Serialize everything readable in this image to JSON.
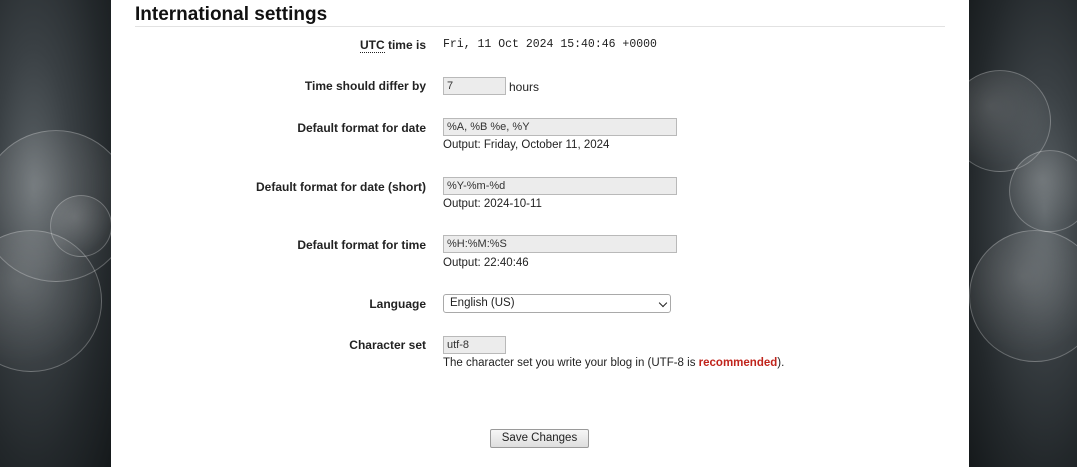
{
  "section": {
    "title": "International settings"
  },
  "utc": {
    "label_abbr": "UTC",
    "label_rest": " time is",
    "value": "Fri, 11 Oct 2024 15:40:46 +0000"
  },
  "time_diff": {
    "label": "Time should differ by",
    "value": "7",
    "suffix": "hours"
  },
  "date_format": {
    "label": "Default format for date",
    "value": "%A, %B %e, %Y",
    "output": "Output: Friday, October 11, 2024"
  },
  "date_short_format": {
    "label": "Default format for date (short)",
    "value": "%Y-%m-%d",
    "output": "Output: 2024-10-11"
  },
  "time_format": {
    "label": "Default format for time",
    "value": "%H:%M:%S",
    "output": "Output: 22:40:46"
  },
  "language": {
    "label": "Language",
    "selected": "English (US)"
  },
  "charset": {
    "label": "Character set",
    "value": "utf-8",
    "note_before": "The character set you write your blog in (UTF-8 is ",
    "note_emphasis": "recommended",
    "note_after": ")."
  },
  "actions": {
    "save_label": "Save Changes"
  },
  "colors": {
    "emphasis": "#c0241c",
    "page_bg": "#ffffff",
    "side_bg": "#1f2326"
  }
}
